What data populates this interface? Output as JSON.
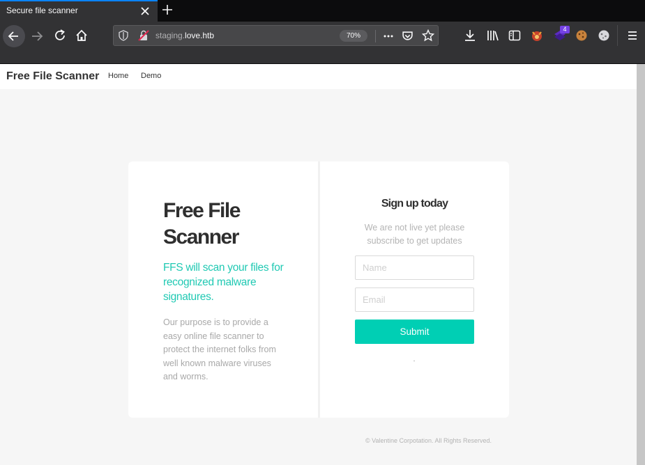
{
  "browser": {
    "tab_title": "Secure file scanner",
    "url_prefix": "staging.",
    "url_host": "love.htb",
    "zoom": "70%",
    "extension_badge": "4"
  },
  "site": {
    "brand": "Free File Scanner",
    "nav": [
      {
        "label": "Home"
      },
      {
        "label": "Demo"
      }
    ]
  },
  "hero": {
    "title": "Free File Scanner",
    "tagline": "FFS will scan your files for recognized malware signatures.",
    "description": "Our purpose is to provide a easy online file scanner to protect the internet folks from well known malware viruses and worms."
  },
  "signup": {
    "title": "Sign up today",
    "subtitle": "We are not live yet please subscribe to get updates",
    "name_placeholder": "Name",
    "email_placeholder": "Email",
    "submit_label": "Submit"
  },
  "footer": {
    "text": "© Valentine Corpotation. All Rights Reserved."
  },
  "colors": {
    "accent": "#00cfb4",
    "tagline": "#20c9b3",
    "browser_chrome": "#323234"
  }
}
